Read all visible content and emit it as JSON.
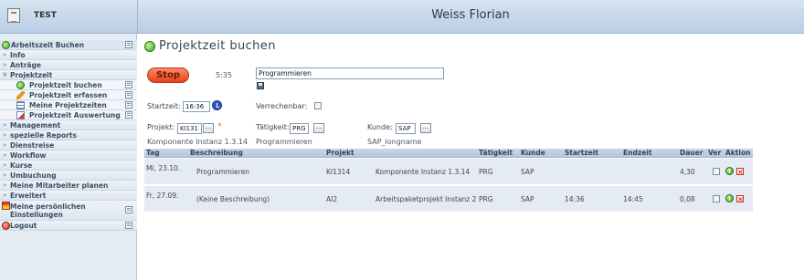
{
  "header": {
    "app_title": "TEST",
    "user_name": "Weiss Florian"
  },
  "sidebar": {
    "items": [
      {
        "label": "Arbeitszeit Buchen"
      },
      {
        "label": "Info"
      },
      {
        "label": "Anträge"
      },
      {
        "label": "Projektzeit"
      },
      {
        "label": "Projektzeit buchen"
      },
      {
        "label": "Projektzeit erfassen"
      },
      {
        "label": "Meine Projektzeiten"
      },
      {
        "label": "Projektzeit Auswertung"
      },
      {
        "label": "Management"
      },
      {
        "label": "spezielle Reports"
      },
      {
        "label": "Dienstreise"
      },
      {
        "label": "Workflow"
      },
      {
        "label": "Kurse"
      },
      {
        "label": "Umbuchung"
      },
      {
        "label": "Meine Mitarbeiter planen"
      },
      {
        "label": "Erweitert"
      },
      {
        "label": "Meine persönlichen Einstellungen"
      },
      {
        "label": "Logout"
      }
    ]
  },
  "main": {
    "title": "Projektzeit buchen",
    "stop_label": "Stop",
    "elapsed": "5:35",
    "description_value": "Programmieren",
    "startzeit_label": "Startzeit:",
    "startzeit_value": "16:36",
    "verrechenbar_label": "Verrechenbar:",
    "projekt_label": "Projekt:",
    "projekt_value": "KI131",
    "projekt_name": "Komponente Instanz 1.3.14",
    "taetigkeit_label": "Tätigkeit:",
    "taetigkeit_value": "PRG",
    "taetigkeit_name": "Programmieren",
    "kunde_label": "Kunde:",
    "kunde_value": "SAP",
    "kunde_name": "SAP_longname",
    "dots": "..."
  },
  "table": {
    "columns": [
      "Tag",
      "Beschreibung",
      "Projekt",
      "Tätigkeit",
      "Kunde",
      "Startzeit",
      "Endzeit",
      "Dauer",
      "Ver",
      "Aktion"
    ],
    "rows": [
      {
        "tag": "Mi, 23.10.",
        "beschreibung": "Programmieren",
        "projekt": "KI1314",
        "projekt_name": "Komponente Instanz 1.3.14",
        "taetigkeit": "PRG",
        "kunde": "SAP",
        "startzeit": "",
        "endzeit": "",
        "dauer": "4,30"
      },
      {
        "tag": "Fr, 27.09.",
        "beschreibung": "(Keine Beschreibung)",
        "projekt": "AI2",
        "projekt_name": "Arbeitspaketprojekt Instanz 2",
        "taetigkeit": "PRG",
        "kunde": "SAP",
        "startzeit": "14:36",
        "endzeit": "14:45",
        "dauer": "0,08"
      }
    ]
  },
  "icons": {
    "active": "green-circle-icon",
    "logout": "red-circle-icon",
    "pin": "pin-icon",
    "clock": "clock-icon",
    "save": "save-icon",
    "ok": "ok-icon",
    "delete": "delete-icon"
  },
  "colors": {
    "stop_button": "#e6421c",
    "table_header": "#b6c7da",
    "row_bg": "#e4ebf2",
    "required_star": "#e06a00"
  }
}
